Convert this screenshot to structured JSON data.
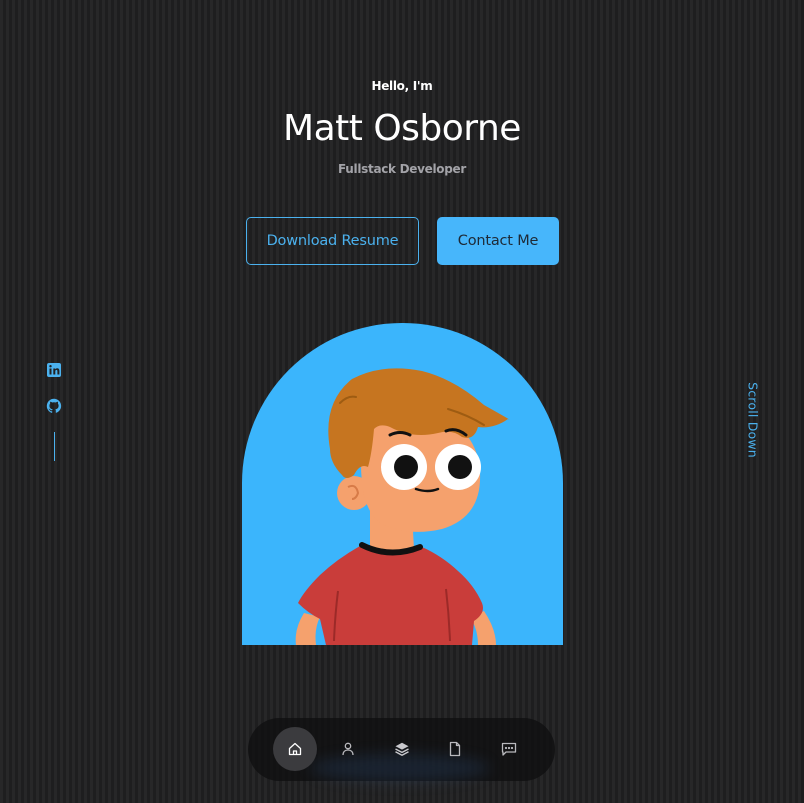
{
  "hero": {
    "greeting": "Hello, I'm",
    "name": "Matt Osborne",
    "role": "Fullstack Developer",
    "download_label": "Download Resume",
    "contact_label": "Contact Me"
  },
  "socials": [
    {
      "icon": "linkedin-icon"
    },
    {
      "icon": "github-icon"
    }
  ],
  "scroll": {
    "label": "Scroll Down"
  },
  "nav": {
    "active": "home",
    "items": [
      {
        "id": "home",
        "icon": "home-icon"
      },
      {
        "id": "about",
        "icon": "user-icon"
      },
      {
        "id": "experience",
        "icon": "layers-icon"
      },
      {
        "id": "services",
        "icon": "file-icon"
      },
      {
        "id": "contact",
        "icon": "message-icon"
      }
    ]
  },
  "colors": {
    "background": "#212122",
    "accent": "#4bb1ee",
    "button_fill": "#47b6fb",
    "avatar_bg": "#3bb5fc",
    "text": "#ffffff",
    "muted_text": "#a3a3a8"
  }
}
